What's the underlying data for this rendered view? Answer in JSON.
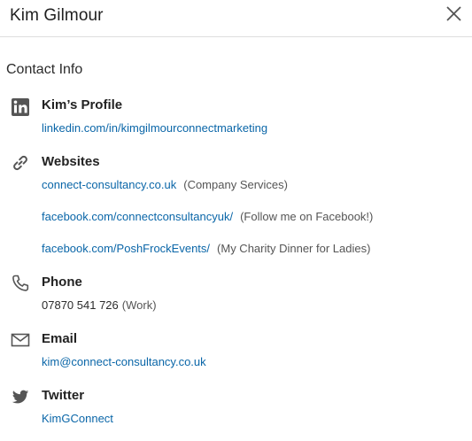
{
  "header": {
    "title": "Kim Gilmour",
    "close_icon": "close-icon"
  },
  "section_title": "Contact Info",
  "colors": {
    "link": "#0a66a8",
    "icon": "#555555",
    "divider": "#dedede"
  },
  "profile": {
    "icon": "linkedin-icon",
    "label": "Kim’s Profile",
    "url": "linkedin.com/in/kimgilmourconnectmarketing"
  },
  "websites": {
    "icon": "link-icon",
    "label": "Websites",
    "items": [
      {
        "url": "connect-consultancy.co.uk",
        "note": "(Company Services)"
      },
      {
        "url": "facebook.com/connectconsultancyuk/",
        "note": "(Follow me on Facebook!)"
      },
      {
        "url": "facebook.com/PoshFrockEvents/",
        "note": "(My Charity Dinner for Ladies)"
      }
    ]
  },
  "phone": {
    "icon": "phone-icon",
    "label": "Phone",
    "number": "07870 541 726",
    "type": "(Work)"
  },
  "email": {
    "icon": "envelope-icon",
    "label": "Email",
    "address": "kim@connect-consultancy.co.uk"
  },
  "twitter": {
    "icon": "twitter-icon",
    "label": "Twitter",
    "handle": "KimGConnect"
  }
}
